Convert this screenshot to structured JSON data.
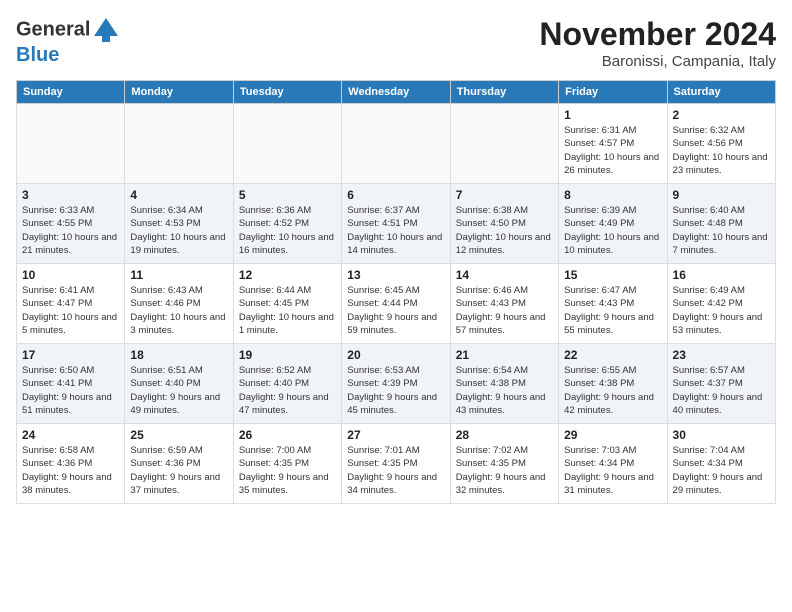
{
  "header": {
    "logo_line1": "General",
    "logo_line2": "Blue",
    "month_title": "November 2024",
    "location": "Baronissi, Campania, Italy"
  },
  "weekdays": [
    "Sunday",
    "Monday",
    "Tuesday",
    "Wednesday",
    "Thursday",
    "Friday",
    "Saturday"
  ],
  "rows": [
    [
      {
        "day": "",
        "info": ""
      },
      {
        "day": "",
        "info": ""
      },
      {
        "day": "",
        "info": ""
      },
      {
        "day": "",
        "info": ""
      },
      {
        "day": "",
        "info": ""
      },
      {
        "day": "1",
        "info": "Sunrise: 6:31 AM\nSunset: 4:57 PM\nDaylight: 10 hours and 26 minutes."
      },
      {
        "day": "2",
        "info": "Sunrise: 6:32 AM\nSunset: 4:56 PM\nDaylight: 10 hours and 23 minutes."
      }
    ],
    [
      {
        "day": "3",
        "info": "Sunrise: 6:33 AM\nSunset: 4:55 PM\nDaylight: 10 hours and 21 minutes."
      },
      {
        "day": "4",
        "info": "Sunrise: 6:34 AM\nSunset: 4:53 PM\nDaylight: 10 hours and 19 minutes."
      },
      {
        "day": "5",
        "info": "Sunrise: 6:36 AM\nSunset: 4:52 PM\nDaylight: 10 hours and 16 minutes."
      },
      {
        "day": "6",
        "info": "Sunrise: 6:37 AM\nSunset: 4:51 PM\nDaylight: 10 hours and 14 minutes."
      },
      {
        "day": "7",
        "info": "Sunrise: 6:38 AM\nSunset: 4:50 PM\nDaylight: 10 hours and 12 minutes."
      },
      {
        "day": "8",
        "info": "Sunrise: 6:39 AM\nSunset: 4:49 PM\nDaylight: 10 hours and 10 minutes."
      },
      {
        "day": "9",
        "info": "Sunrise: 6:40 AM\nSunset: 4:48 PM\nDaylight: 10 hours and 7 minutes."
      }
    ],
    [
      {
        "day": "10",
        "info": "Sunrise: 6:41 AM\nSunset: 4:47 PM\nDaylight: 10 hours and 5 minutes."
      },
      {
        "day": "11",
        "info": "Sunrise: 6:43 AM\nSunset: 4:46 PM\nDaylight: 10 hours and 3 minutes."
      },
      {
        "day": "12",
        "info": "Sunrise: 6:44 AM\nSunset: 4:45 PM\nDaylight: 10 hours and 1 minute."
      },
      {
        "day": "13",
        "info": "Sunrise: 6:45 AM\nSunset: 4:44 PM\nDaylight: 9 hours and 59 minutes."
      },
      {
        "day": "14",
        "info": "Sunrise: 6:46 AM\nSunset: 4:43 PM\nDaylight: 9 hours and 57 minutes."
      },
      {
        "day": "15",
        "info": "Sunrise: 6:47 AM\nSunset: 4:43 PM\nDaylight: 9 hours and 55 minutes."
      },
      {
        "day": "16",
        "info": "Sunrise: 6:49 AM\nSunset: 4:42 PM\nDaylight: 9 hours and 53 minutes."
      }
    ],
    [
      {
        "day": "17",
        "info": "Sunrise: 6:50 AM\nSunset: 4:41 PM\nDaylight: 9 hours and 51 minutes."
      },
      {
        "day": "18",
        "info": "Sunrise: 6:51 AM\nSunset: 4:40 PM\nDaylight: 9 hours and 49 minutes."
      },
      {
        "day": "19",
        "info": "Sunrise: 6:52 AM\nSunset: 4:40 PM\nDaylight: 9 hours and 47 minutes."
      },
      {
        "day": "20",
        "info": "Sunrise: 6:53 AM\nSunset: 4:39 PM\nDaylight: 9 hours and 45 minutes."
      },
      {
        "day": "21",
        "info": "Sunrise: 6:54 AM\nSunset: 4:38 PM\nDaylight: 9 hours and 43 minutes."
      },
      {
        "day": "22",
        "info": "Sunrise: 6:55 AM\nSunset: 4:38 PM\nDaylight: 9 hours and 42 minutes."
      },
      {
        "day": "23",
        "info": "Sunrise: 6:57 AM\nSunset: 4:37 PM\nDaylight: 9 hours and 40 minutes."
      }
    ],
    [
      {
        "day": "24",
        "info": "Sunrise: 6:58 AM\nSunset: 4:36 PM\nDaylight: 9 hours and 38 minutes."
      },
      {
        "day": "25",
        "info": "Sunrise: 6:59 AM\nSunset: 4:36 PM\nDaylight: 9 hours and 37 minutes."
      },
      {
        "day": "26",
        "info": "Sunrise: 7:00 AM\nSunset: 4:35 PM\nDaylight: 9 hours and 35 minutes."
      },
      {
        "day": "27",
        "info": "Sunrise: 7:01 AM\nSunset: 4:35 PM\nDaylight: 9 hours and 34 minutes."
      },
      {
        "day": "28",
        "info": "Sunrise: 7:02 AM\nSunset: 4:35 PM\nDaylight: 9 hours and 32 minutes."
      },
      {
        "day": "29",
        "info": "Sunrise: 7:03 AM\nSunset: 4:34 PM\nDaylight: 9 hours and 31 minutes."
      },
      {
        "day": "30",
        "info": "Sunrise: 7:04 AM\nSunset: 4:34 PM\nDaylight: 9 hours and 29 minutes."
      }
    ]
  ]
}
